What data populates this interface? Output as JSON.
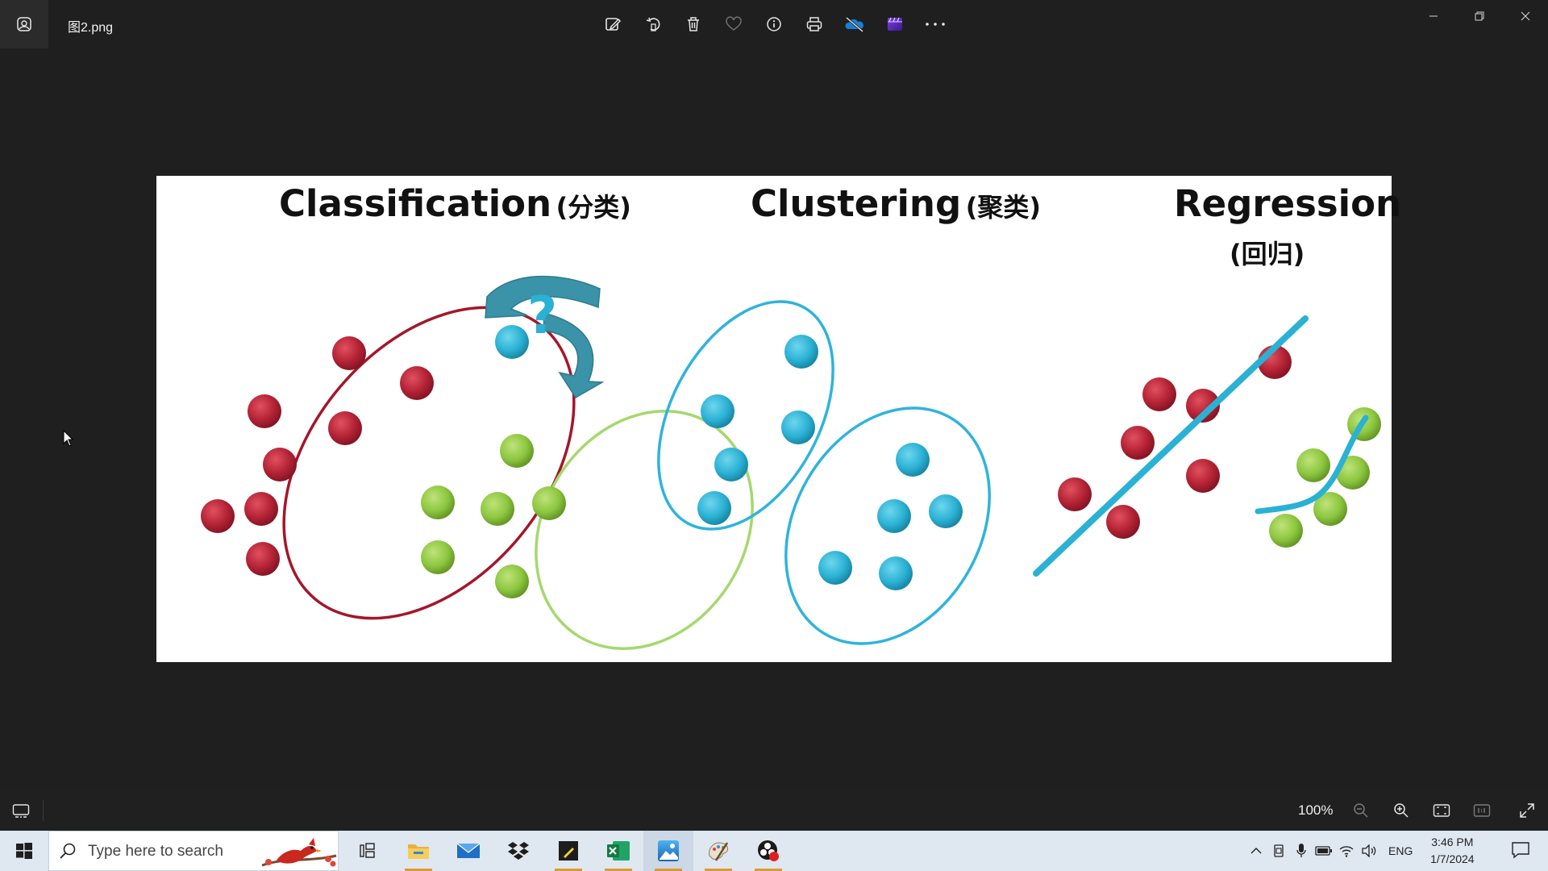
{
  "window": {
    "file_name": "图2.png",
    "app_icon": "photos-icon",
    "toolbar": [
      {
        "name": "edit-image-icon"
      },
      {
        "name": "rotate-icon"
      },
      {
        "name": "delete-icon"
      },
      {
        "name": "favorite-icon"
      },
      {
        "name": "info-icon"
      },
      {
        "name": "print-icon"
      },
      {
        "name": "onedrive-icon"
      },
      {
        "name": "clipchamp-icon"
      },
      {
        "name": "more-icon"
      }
    ],
    "controls": [
      "minimize-icon",
      "restore-icon",
      "close-icon"
    ]
  },
  "image": {
    "classification": {
      "title": "Classification",
      "subtitle": "(分类)",
      "question_mark": "?"
    },
    "clustering": {
      "title": "Clustering",
      "subtitle": "(聚类)"
    },
    "regression": {
      "title": "Regression",
      "subtitle": "(回归)"
    },
    "colors": {
      "red": "#b22234",
      "green": "#8cc63f",
      "cyan": "#2ab1d4",
      "red_ring": "#a3172a",
      "green_ring": "#a5d86e",
      "cyan_ring": "#2fb3dc",
      "arrow": "#3a93a8"
    }
  },
  "statusbar": {
    "zoom": "100%"
  },
  "taskbar": {
    "search_placeholder": "Type here to search",
    "language": "ENG",
    "time": "3:46 PM",
    "date": "1/7/2024"
  }
}
